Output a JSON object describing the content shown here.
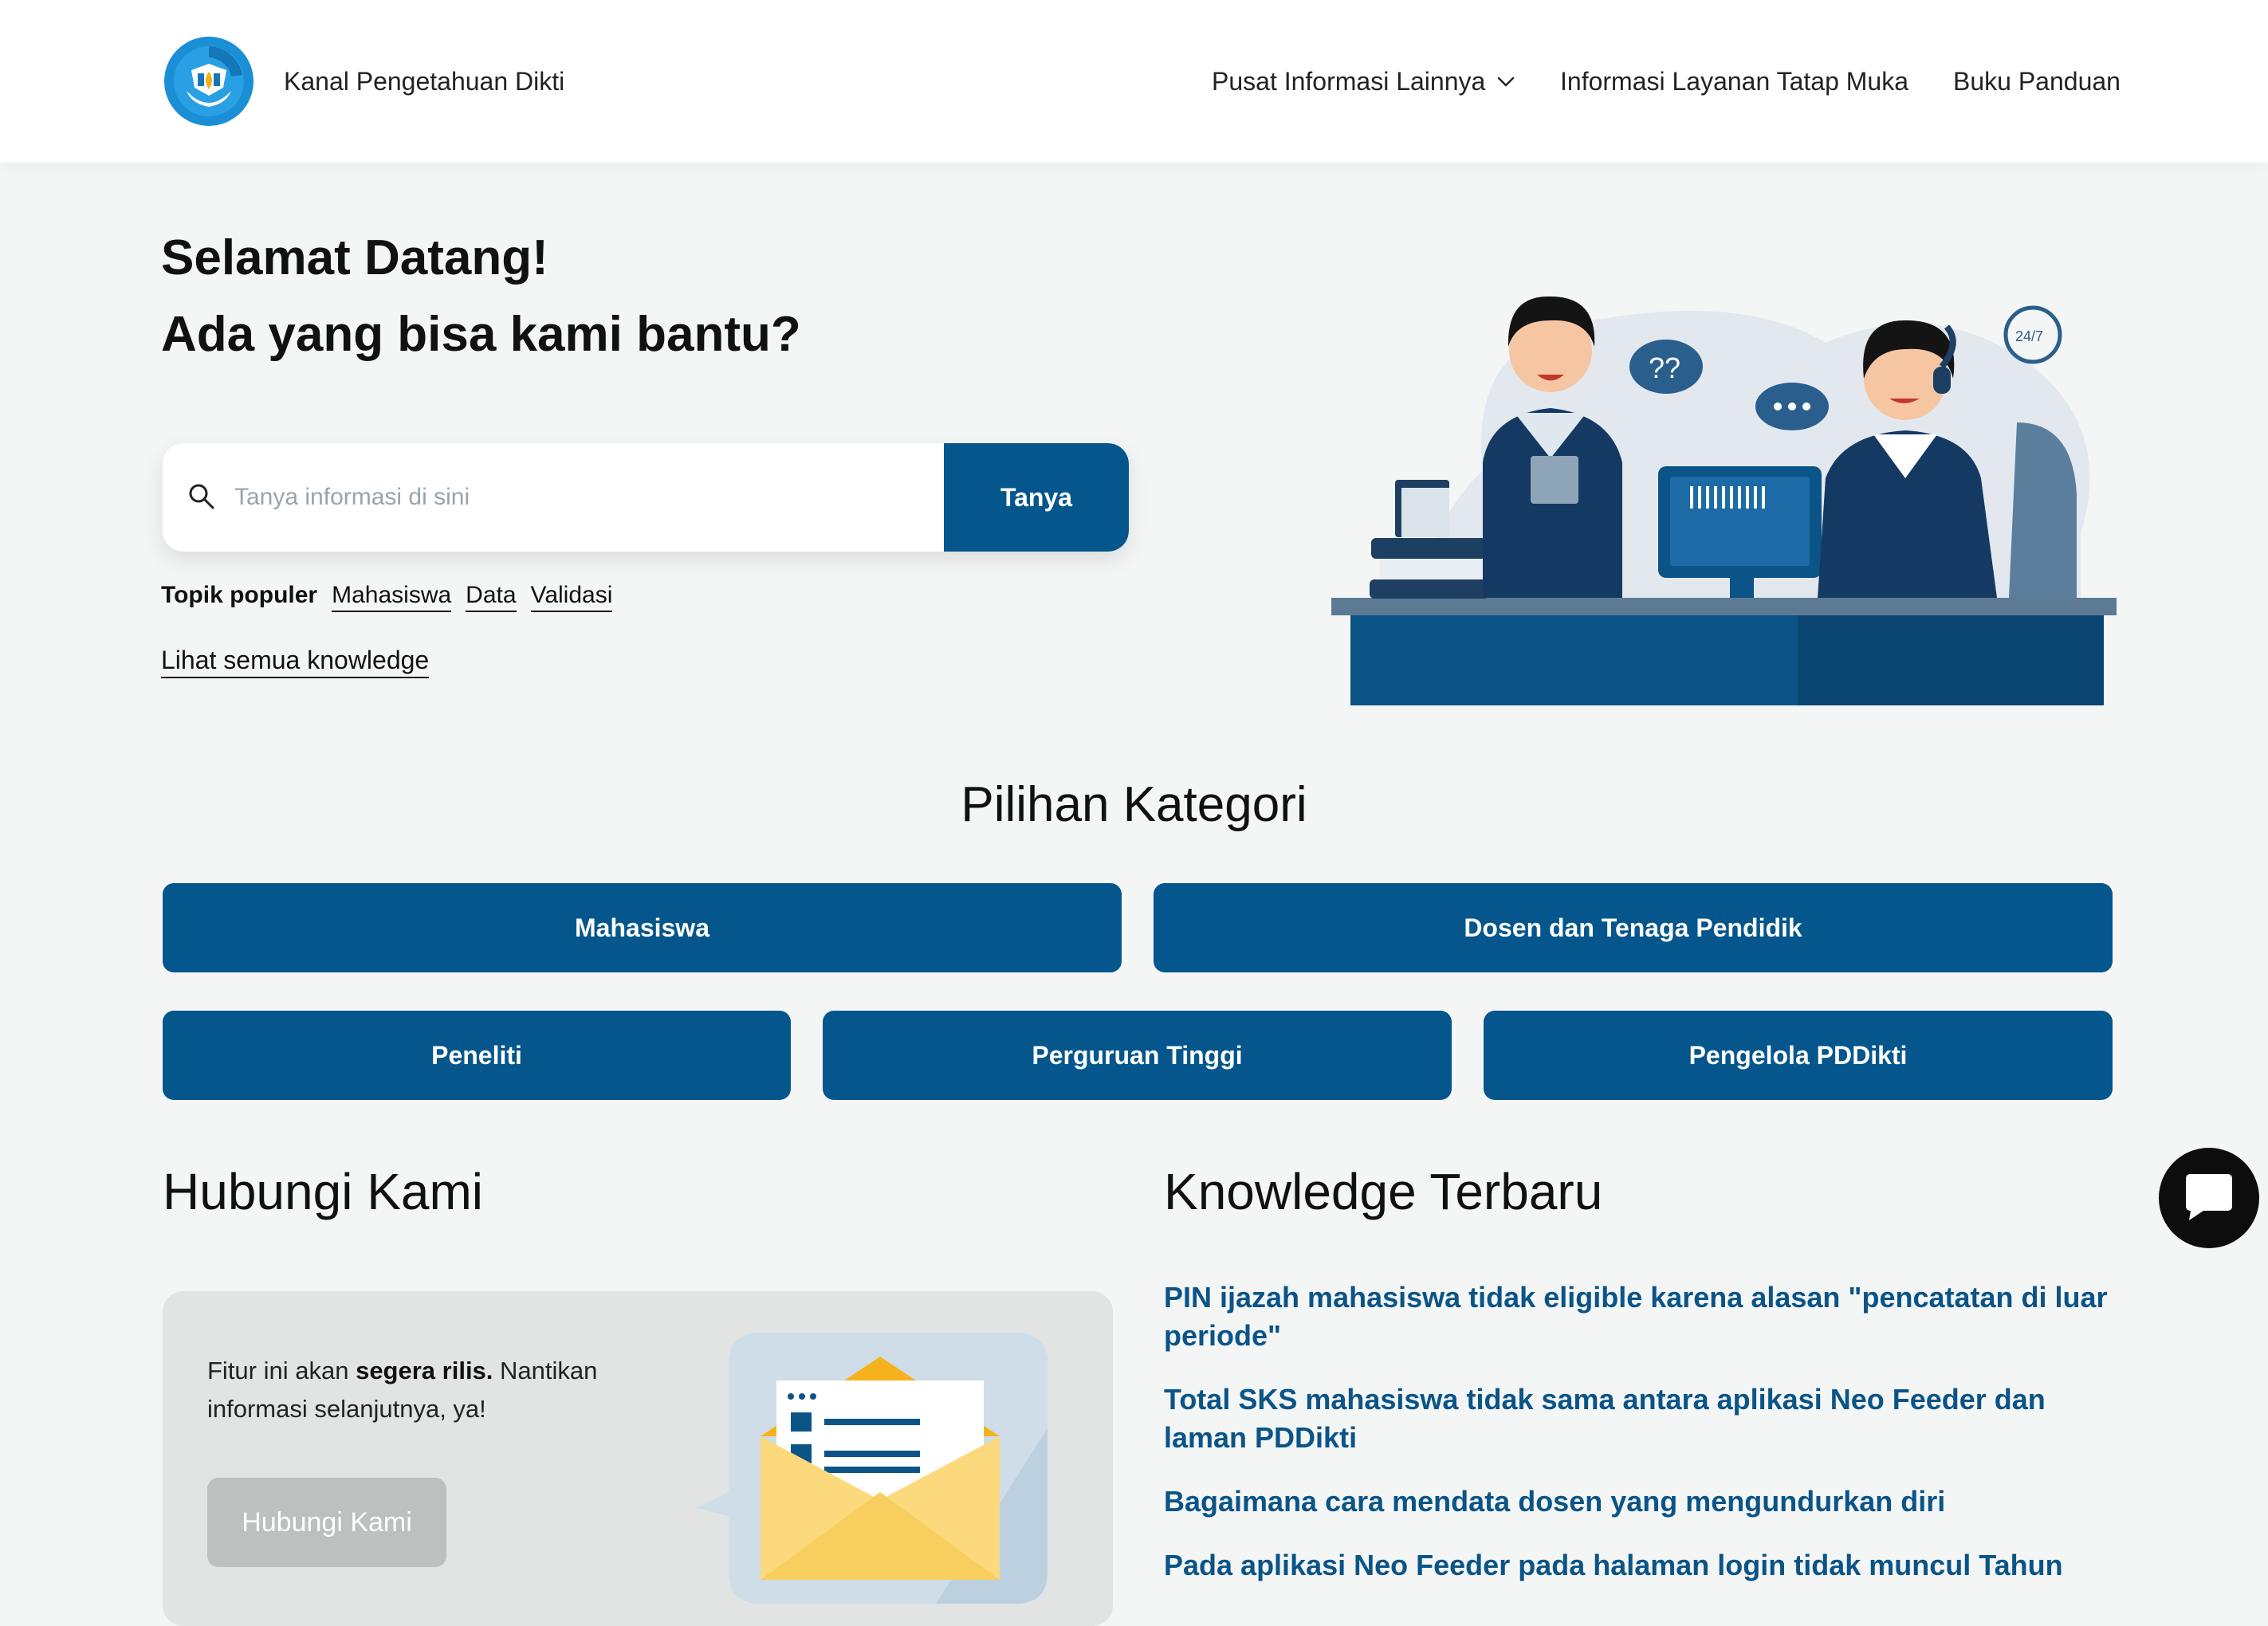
{
  "header": {
    "brand": "Kanal Pengetahuan Dikti",
    "nav": [
      {
        "label": "Pusat Informasi Lainnya"
      },
      {
        "label": "Informasi Layanan Tatap Muka"
      },
      {
        "label": "Buku Panduan"
      }
    ]
  },
  "hero": {
    "title_line1": "Selamat Datang!",
    "title_line2": "Ada yang bisa kami bantu?",
    "search_placeholder": "Tanya informasi di sini",
    "search_button": "Tanya",
    "popular_label": "Topik populer",
    "popular_topics": [
      "Mahasiswa",
      "Data",
      "Validasi"
    ],
    "see_all": "Lihat semua knowledge"
  },
  "categories": {
    "title": "Pilihan Kategori",
    "items": [
      "Mahasiswa",
      "Dosen dan Tenaga Pendidik",
      "Peneliti",
      "Perguruan Tinggi",
      "Pengelola PDDikti"
    ]
  },
  "contact": {
    "title": "Hubungi Kami",
    "text_pre": "Fitur ini akan ",
    "text_bold": "segera rilis.",
    "text_post": " Nantikan informasi selanjutnya, ya!",
    "button": "Hubungi Kami"
  },
  "knowledge": {
    "title": "Knowledge Terbaru",
    "items": [
      "PIN ijazah mahasiswa tidak eligible karena alasan \"pencatatan di luar periode\"",
      "Total SKS mahasiswa tidak sama antara aplikasi Neo Feeder dan laman PDDikti",
      "Bagaimana cara mendata dosen yang mengundurkan diri",
      "Pada aplikasi Neo Feeder pada halaman login tidak muncul Tahun"
    ]
  },
  "colors": {
    "primary": "#04568c",
    "link": "#0a5488",
    "background": "#f4f5f5"
  },
  "icons": {
    "search": "search-icon",
    "chevron": "chevron-down-icon",
    "chat": "chat-bubble-icon"
  }
}
